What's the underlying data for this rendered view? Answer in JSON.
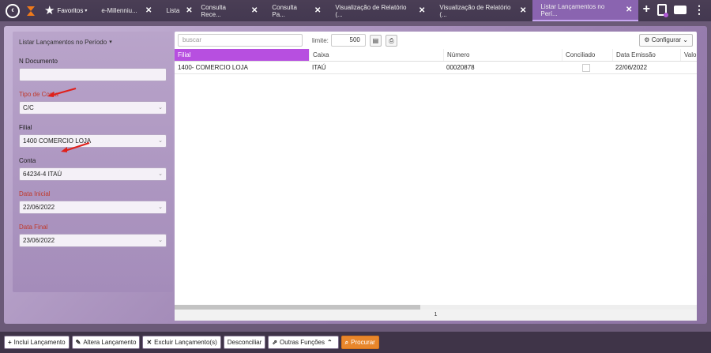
{
  "topbar": {
    "back_icon": "arrow-left-circle-icon",
    "favorites_label": "Favoritos",
    "tabs": [
      {
        "label": "e-Millenniu..."
      },
      {
        "label": "Lista"
      },
      {
        "label": "Consulta Rece..."
      },
      {
        "label": "Consulta Pa..."
      },
      {
        "label": "Visualização de Relatório (..."
      },
      {
        "label": "Visualização de Relatório (..."
      },
      {
        "label": "Listar Lançamentos no Perí..."
      }
    ],
    "close_glyph": "✕"
  },
  "filters": {
    "title": "Listar Lançamentos no Período",
    "n_documento_label": "N Documento",
    "n_documento_value": "",
    "tipo_conta_label": "Tipo de Conta",
    "tipo_conta_value": "C/C",
    "filial_label": "Filial",
    "filial_value": "1400  COMERCIO LOJA",
    "conta_label": "Conta",
    "conta_value": "64234-4 ITAÚ",
    "data_inicial_label": "Data Inicial",
    "data_inicial_value": "22/06/2022",
    "data_final_label": "Data Final",
    "data_final_value": "23/06/2022"
  },
  "toolbar": {
    "search_placeholder": "buscar",
    "limit_label": "limite:",
    "limit_value": "500",
    "config_label": "Configurar"
  },
  "grid": {
    "columns": [
      "Filial",
      "Caixa",
      "Número",
      "Conciliado",
      "Data Emissão",
      "Valo"
    ],
    "rows": [
      {
        "filial": "1400- COMERCIO LOJA",
        "caixa": "ITAÚ",
        "numero": "00020878",
        "data_emissao": "22/06/2022"
      }
    ],
    "page": "1"
  },
  "bottombar": {
    "inclui": "Inclui Lançamento",
    "altera": "Altera Lançamento",
    "excluir": "Excluir Lançamento(s)",
    "desconciliar": "Desconciliar",
    "outras": "Outras Funções",
    "procurar": "Procurar"
  },
  "colors": {
    "accent": "#b74fe0",
    "primary_button": "#e8862b",
    "annotation_arrow": "#e0201b",
    "required_label": "#c0392b"
  }
}
